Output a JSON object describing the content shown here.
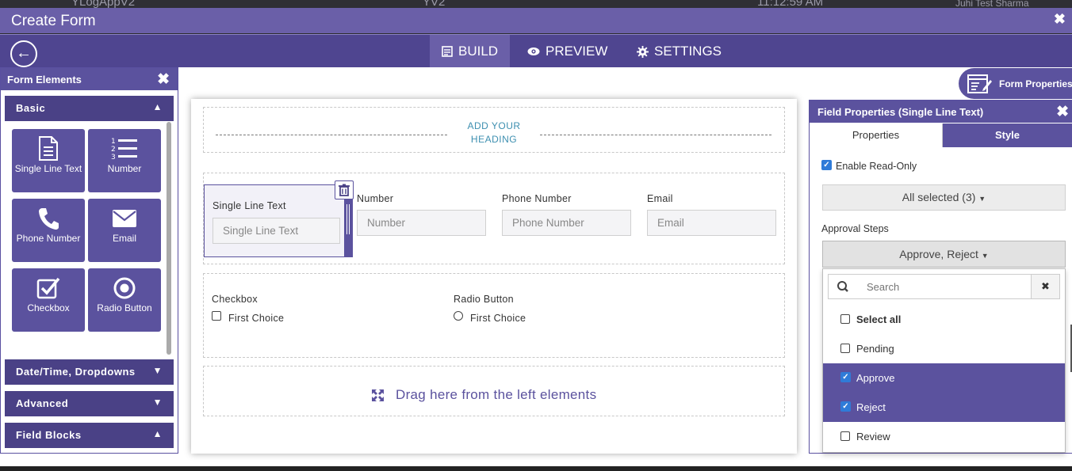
{
  "underlying": {
    "app_name": "YLogAppV2",
    "center_text": "YV2",
    "time": "11:12:59 AM",
    "user": "Juhi Test Sharma"
  },
  "titlebar": {
    "title": "Create Form",
    "close": "✖"
  },
  "nav": {
    "back": "←",
    "tabs": [
      {
        "label": "BUILD",
        "icon": "build-icon"
      },
      {
        "label": "PREVIEW",
        "icon": "eye-icon"
      },
      {
        "label": "SETTINGS",
        "icon": "gear-icon"
      }
    ]
  },
  "left_panel": {
    "title": "Form Elements",
    "close": "✖",
    "sections": {
      "basic": "Basic",
      "datetime": "Date/Time, Dropdowns",
      "advanced": "Advanced",
      "field_blocks": "Field Blocks"
    },
    "tiles": [
      {
        "label": "Single Line Text",
        "icon": "document-icon"
      },
      {
        "label": "Number",
        "icon": "numbered-list-icon"
      },
      {
        "label": "Phone Number",
        "icon": "phone-icon"
      },
      {
        "label": "Email",
        "icon": "envelope-icon"
      },
      {
        "label": "Checkbox",
        "icon": "checkbox-icon"
      },
      {
        "label": "Radio Button",
        "icon": "radio-icon"
      }
    ]
  },
  "canvas": {
    "heading": "ADD YOUR HEADING",
    "fields": [
      {
        "label": "Single Line Text",
        "placeholder": "Single Line Text"
      },
      {
        "label": "Number",
        "placeholder": "Number"
      },
      {
        "label": "Phone Number",
        "placeholder": "Phone Number"
      },
      {
        "label": "Email",
        "placeholder": "Email"
      }
    ],
    "checkbox": {
      "label": "Checkbox",
      "option": "First Choice"
    },
    "radio": {
      "label": "Radio Button",
      "option": "First Choice"
    },
    "drop_hint": "Drag here from the left elements"
  },
  "form_properties": {
    "label": "Form Properties"
  },
  "field_properties": {
    "title": "Field Properties (Single Line Text)",
    "close": "✖",
    "tabs": {
      "properties": "Properties",
      "style": "Style"
    },
    "read_only": {
      "label": "Enable Read-Only",
      "checked": true
    },
    "all_selected": "All selected (3)",
    "approval_label": "Approval Steps",
    "approval_value": "Approve, Reject",
    "search_placeholder": "Search",
    "clear": "✖",
    "options": [
      {
        "label": "Select all",
        "checked": false,
        "bold": true
      },
      {
        "label": "Pending",
        "checked": false
      },
      {
        "label": "Approve",
        "checked": true
      },
      {
        "label": "Reject",
        "checked": true
      },
      {
        "label": "Review",
        "checked": false
      }
    ]
  },
  "colors": {
    "primary": "#5b529e",
    "title": "#6a5fa8",
    "nav": "#4f4590",
    "accent": "#3d8fb0",
    "check": "#2f7bd8"
  }
}
